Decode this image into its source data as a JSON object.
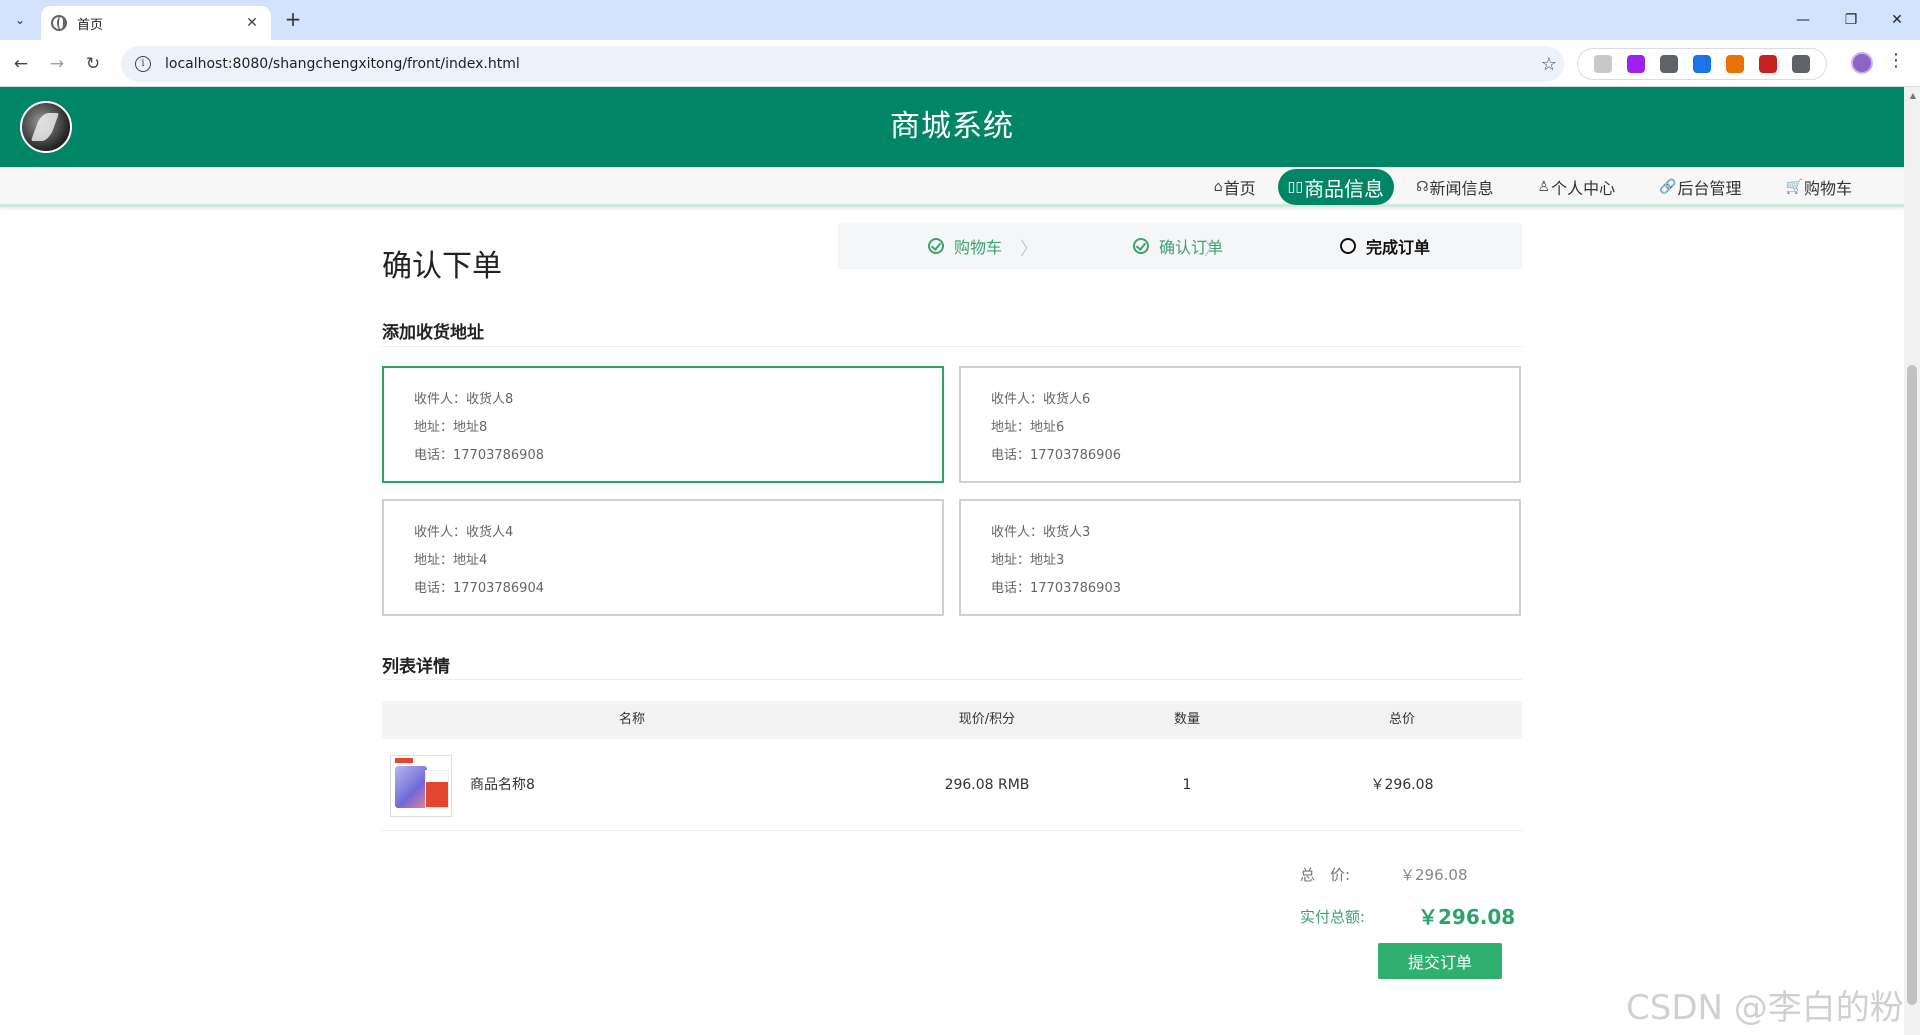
{
  "browser": {
    "tab_title": "首页",
    "url": "localhost:8080/shangchengxitong/front/index.html",
    "ext_colors": [
      "#c8c8c8",
      "#a020f0",
      "#5f6368",
      "#1a73e8",
      "#e8710a",
      "#c5221f",
      "#5f6368"
    ]
  },
  "site": {
    "title": "商城系统",
    "accent_color": "#008566",
    "nav": [
      {
        "icon": "⌂",
        "label": "首页",
        "active": false
      },
      {
        "icon": "▯▯",
        "label": "商品信息",
        "active": true
      },
      {
        "icon": "☊",
        "label": "新闻信息",
        "active": false
      },
      {
        "icon": "♙",
        "label": "个人中心",
        "active": false
      },
      {
        "icon": "🔗",
        "label": "后台管理",
        "active": false
      },
      {
        "icon": "🛒",
        "label": "购物车",
        "active": false
      }
    ]
  },
  "order": {
    "page_title": "确认下单",
    "steps": [
      {
        "label": "购物车",
        "state": "done"
      },
      {
        "label": "确认订单",
        "state": "done"
      },
      {
        "label": "完成订单",
        "state": "current"
      }
    ],
    "address_section_title": "添加收货地址",
    "addresses": [
      {
        "receiver": "收件人：收货人8",
        "address": "地址：地址8",
        "phone": "电话：17703786908",
        "selected": true
      },
      {
        "receiver": "收件人：收货人6",
        "address": "地址：地址6",
        "phone": "电话：17703786906",
        "selected": false
      },
      {
        "receiver": "收件人：收货人4",
        "address": "地址：地址4",
        "phone": "电话：17703786904",
        "selected": false
      },
      {
        "receiver": "收件人：收货人3",
        "address": "地址：地址3",
        "phone": "电话：17703786903",
        "selected": false
      }
    ],
    "list_section_title": "列表详情",
    "table": {
      "headers": [
        "名称",
        "现价/积分",
        "数量",
        "总价"
      ],
      "rows": [
        {
          "name": "商品名称8",
          "price": "296.08 RMB",
          "quantity": "1",
          "total": "￥296.08"
        }
      ]
    },
    "summary": {
      "total_label": "总　价:",
      "total_value": "￥296.08",
      "pay_label": "实付总额:",
      "pay_value": "￥296.08"
    },
    "submit_label": "提交订单"
  },
  "watermark": "CSDN @李白的粉"
}
